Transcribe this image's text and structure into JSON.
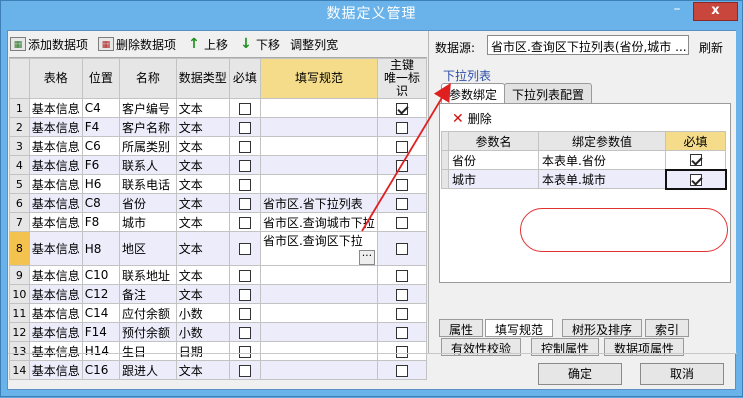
{
  "window": {
    "title": "数据定义管理",
    "close_glyph": "x",
    "minimize_glyph": "–"
  },
  "toolbar": {
    "add": "添加数据项",
    "delete": "删除数据项",
    "up": "上移",
    "down": "下移",
    "adjust": "调整列宽"
  },
  "grid": {
    "headers": [
      "表格",
      "位置",
      "名称",
      "数据类型",
      "必填",
      "填写规范",
      "主键\n唯一标识"
    ],
    "rows": [
      {
        "n": "1",
        "table": "基本信息",
        "pos": "C4",
        "name": "客户编号",
        "type": "文本",
        "req": false,
        "rule": "",
        "key": true
      },
      {
        "n": "2",
        "table": "基本信息",
        "pos": "F4",
        "name": "客户名称",
        "type": "文本",
        "req": false,
        "rule": "",
        "key": false
      },
      {
        "n": "3",
        "table": "基本信息",
        "pos": "C6",
        "name": "所属类别",
        "type": "文本",
        "req": false,
        "rule": "",
        "key": false
      },
      {
        "n": "4",
        "table": "基本信息",
        "pos": "F6",
        "name": "联系人",
        "type": "文本",
        "req": false,
        "rule": "",
        "key": false
      },
      {
        "n": "5",
        "table": "基本信息",
        "pos": "H6",
        "name": "联系电话",
        "type": "文本",
        "req": false,
        "rule": "",
        "key": false
      },
      {
        "n": "6",
        "table": "基本信息",
        "pos": "C8",
        "name": "省份",
        "type": "文本",
        "req": false,
        "rule": "省市区.省下拉列表",
        "key": false
      },
      {
        "n": "7",
        "table": "基本信息",
        "pos": "F8",
        "name": "城市",
        "type": "文本",
        "req": false,
        "rule": "省市区.查询城市下拉",
        "key": false
      },
      {
        "n": "8",
        "table": "基本信息",
        "pos": "H8",
        "name": "地区",
        "type": "文本",
        "req": false,
        "rule": "省市区.查询区下拉",
        "key": false
      },
      {
        "n": "9",
        "table": "基本信息",
        "pos": "C10",
        "name": "联系地址",
        "type": "文本",
        "req": false,
        "rule": "",
        "key": false
      },
      {
        "n": "10",
        "table": "基本信息",
        "pos": "C12",
        "name": "备注",
        "type": "文本",
        "req": false,
        "rule": "",
        "key": false
      },
      {
        "n": "11",
        "table": "基本信息",
        "pos": "C14",
        "name": "应付余额",
        "type": "小数",
        "req": false,
        "rule": "",
        "key": false
      },
      {
        "n": "12",
        "table": "基本信息",
        "pos": "F14",
        "name": "预付余额",
        "type": "小数",
        "req": false,
        "rule": "",
        "key": false
      },
      {
        "n": "13",
        "table": "基本信息",
        "pos": "H14",
        "name": "生日",
        "type": "日期",
        "req": false,
        "rule": "",
        "key": false
      },
      {
        "n": "14",
        "table": "基本信息",
        "pos": "C16",
        "name": "跟进人",
        "type": "文本",
        "req": false,
        "rule": "",
        "key": false
      }
    ]
  },
  "right": {
    "ds_label": "数据源:",
    "ds_value": "省市区.查询区下拉列表(省份,城市 ...",
    "refresh": "刷新",
    "dropdown_label": "下拉列表",
    "tabs": [
      "参数绑定",
      "下拉列表配置"
    ],
    "delete": "删除",
    "bind_headers": [
      "参数名",
      "绑定参数值",
      "必填"
    ],
    "bind_rows": [
      {
        "name": "省份",
        "value": "本表单.省份",
        "req": true
      },
      {
        "name": "城市",
        "value": "本表单.城市",
        "req": true
      }
    ],
    "bottom_tabs": [
      "属性",
      "填写规范",
      "树形及排序",
      "索引",
      "有效性校验",
      "控制属性",
      "数据项属性"
    ]
  },
  "footer": {
    "ok": "确定",
    "cancel": "取消"
  }
}
